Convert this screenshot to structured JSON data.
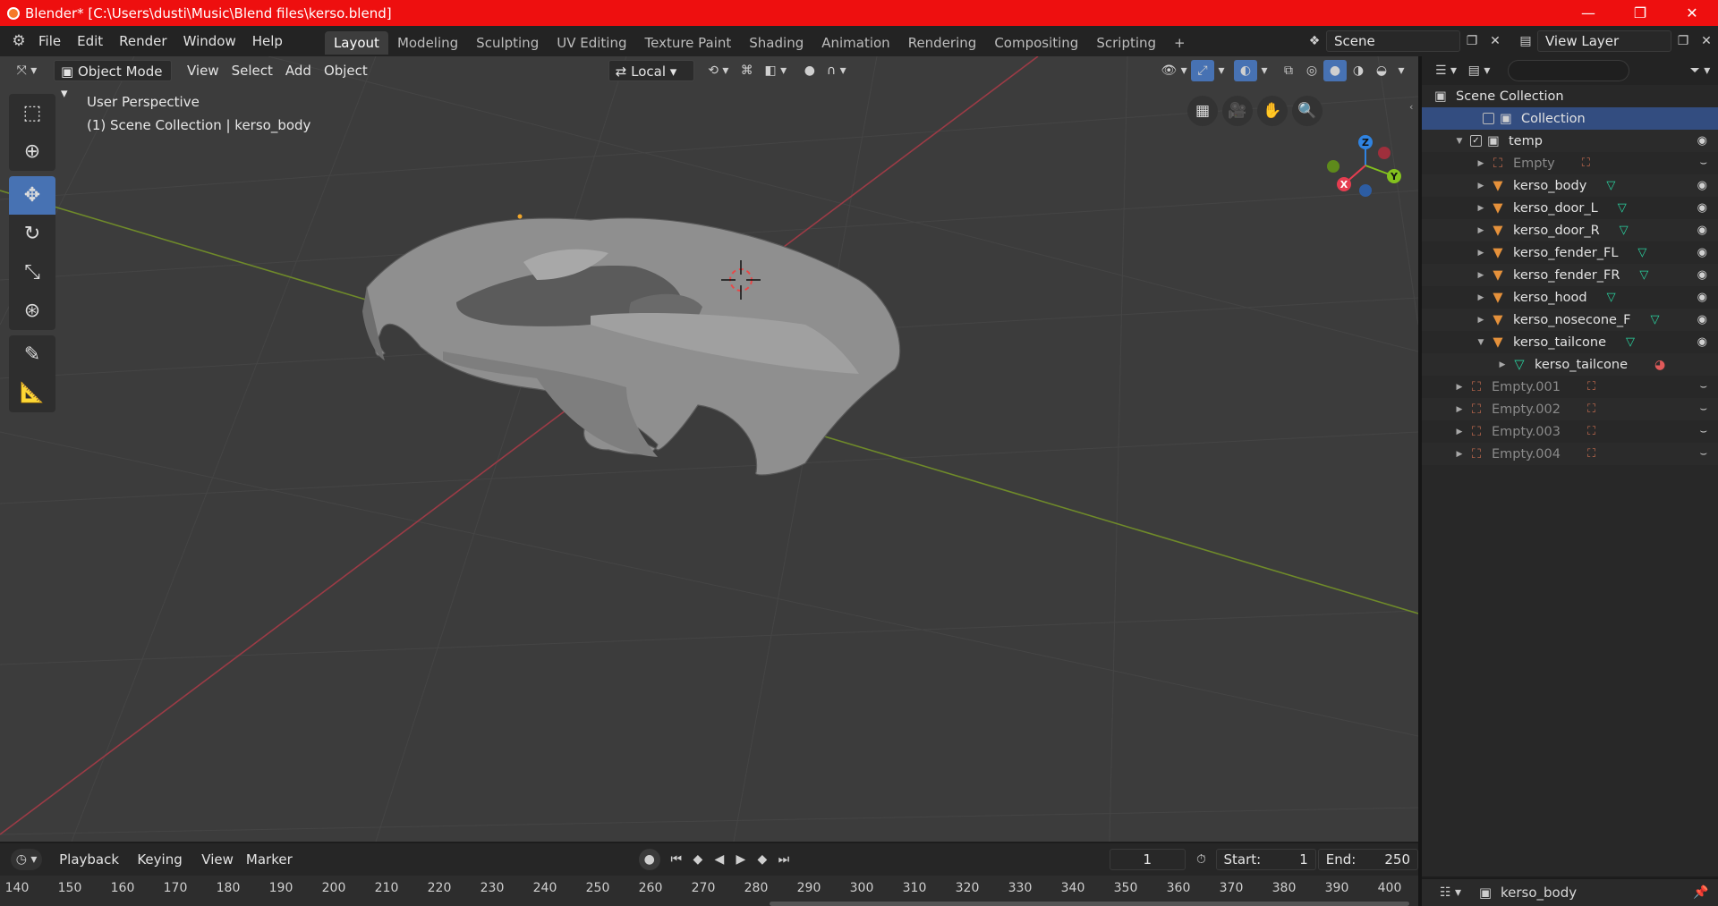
{
  "window": {
    "title": "Blender* [C:\\Users\\dusti\\Music\\Blend files\\kerso.blend]",
    "minimize": "—",
    "restore": "❐",
    "close": "✕"
  },
  "menu": [
    "File",
    "Edit",
    "Render",
    "Window",
    "Help"
  ],
  "workspaces": [
    "Layout",
    "Modeling",
    "Sculpting",
    "UV Editing",
    "Texture Paint",
    "Shading",
    "Animation",
    "Rendering",
    "Compositing",
    "Scripting",
    "+"
  ],
  "scene": {
    "label": "Scene",
    "view_layer": "View Layer"
  },
  "viewport_header": {
    "mode": "Object Mode",
    "menus": [
      "View",
      "Select",
      "Add",
      "Object"
    ],
    "orientation": "Local"
  },
  "viewport": {
    "perspective": "User Perspective",
    "context": "(1) Scene Collection | kerso_body",
    "gizmo": {
      "x": "X",
      "y": "Y",
      "z": "Z"
    }
  },
  "outliner": {
    "search_placeholder": "",
    "root": "Scene Collection",
    "rows": [
      {
        "label": "Collection",
        "type": "collection",
        "selected": true
      },
      {
        "label": "temp",
        "type": "collection"
      },
      {
        "label": "Empty",
        "type": "empty",
        "dim": true
      },
      {
        "label": "kerso_body",
        "type": "mesh"
      },
      {
        "label": "kerso_door_L",
        "type": "mesh"
      },
      {
        "label": "kerso_door_R",
        "type": "mesh"
      },
      {
        "label": "kerso_fender_FL",
        "type": "mesh"
      },
      {
        "label": "kerso_fender_FR",
        "type": "mesh"
      },
      {
        "label": "kerso_hood",
        "type": "mesh"
      },
      {
        "label": "kerso_nosecone_F",
        "type": "mesh"
      },
      {
        "label": "kerso_tailcone",
        "type": "mesh"
      },
      {
        "label": "kerso_tailcone",
        "type": "meshdata"
      },
      {
        "label": "Empty.001",
        "type": "empty",
        "dim": true
      },
      {
        "label": "Empty.002",
        "type": "empty",
        "dim": true
      },
      {
        "label": "Empty.003",
        "type": "empty",
        "dim": true
      },
      {
        "label": "Empty.004",
        "type": "empty",
        "dim": true
      }
    ]
  },
  "properties": {
    "active_object": "kerso_body"
  },
  "timeline": {
    "menus": [
      "Playback",
      "Keying",
      "View",
      "Marker"
    ],
    "current_frame": "1",
    "start_label": "Start:",
    "start": "1",
    "end_label": "End:",
    "end": "250",
    "ticks": [
      "140",
      "150",
      "160",
      "170",
      "180",
      "190",
      "200",
      "210",
      "220",
      "230",
      "240",
      "250",
      "260",
      "270",
      "280",
      "290",
      "300",
      "310",
      "320",
      "330",
      "340",
      "350",
      "360",
      "370",
      "380",
      "390",
      "400"
    ]
  },
  "colors": {
    "accent": "#4772b3",
    "title_bar": "#ee0f0f",
    "mesh_icon": "#e5913b",
    "vertex_icon": "#2ad3a0"
  }
}
